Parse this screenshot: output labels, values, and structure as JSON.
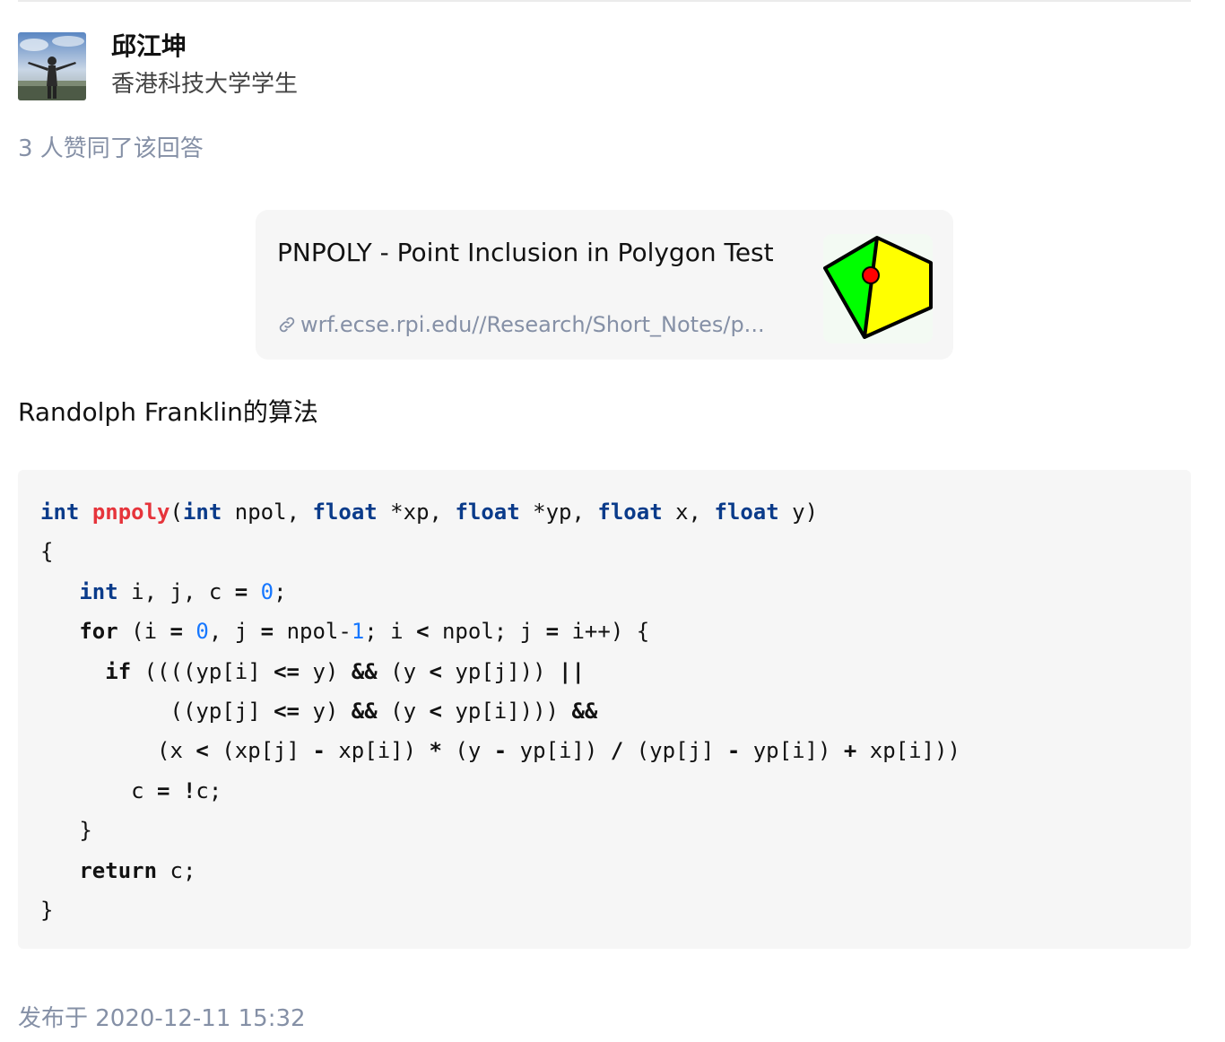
{
  "author": {
    "name": "邱江坤",
    "headline": "香港科技大学学生"
  },
  "votes": {
    "text": "3 人赞同了该回答"
  },
  "link_card": {
    "title": "PNPOLY - Point Inclusion in Polygon Test",
    "url": "wrf.ecse.rpi.edu//Research/Short_Notes/p...",
    "icon": "link-icon",
    "thumb_colors": {
      "left": "#00ff00",
      "right": "#ffff00",
      "point": "#ff0000",
      "stroke": "#000000"
    }
  },
  "paragraph": "Randolph Franklin的算法",
  "code": {
    "language": "c",
    "colors": {
      "keyword": "#0a3b8a",
      "function": "#e6343b",
      "number": "#1677ff"
    },
    "lines": [
      "int pnpoly(int npol, float *xp, float *yp, float x, float y)",
      "{",
      "   int i, j, c = 0;",
      "   for (i = 0, j = npol-1; i < npol; j = i++) {",
      "     if ((((yp[i] <= y) && (y < yp[j])) ||",
      "          ((yp[j] <= y) && (y < yp[i]))) &&",
      "         (x < (xp[j] - xp[i]) * (y - yp[i]) / (yp[j] - yp[i]) + xp[i]))",
      "       c = !c;",
      "   }",
      "   return c;",
      "}"
    ]
  },
  "footer": {
    "published": "发布于 2020-12-11 15:32"
  }
}
